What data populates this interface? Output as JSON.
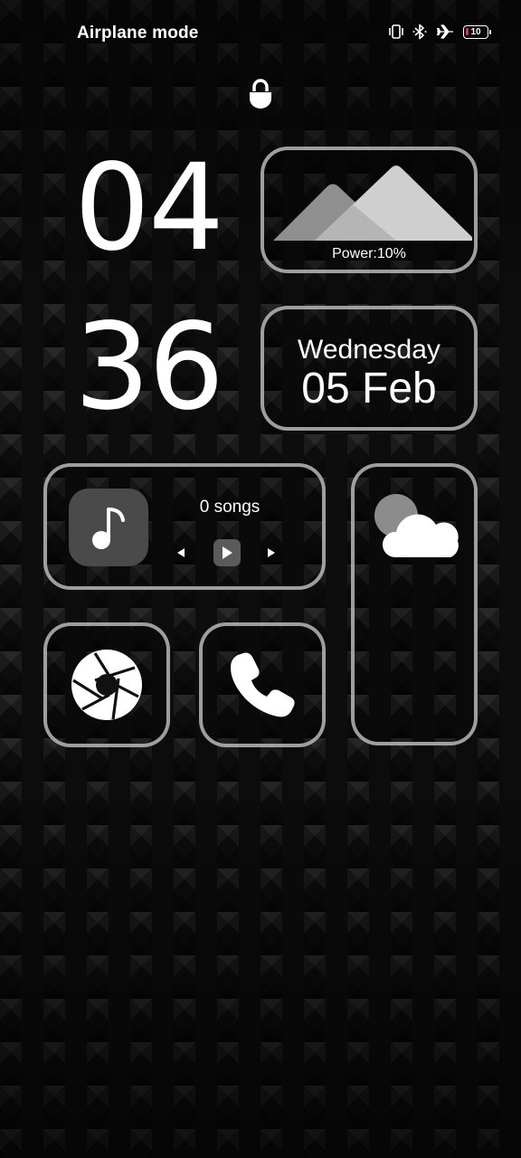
{
  "status_bar": {
    "mode_text": "Airplane mode",
    "icons": [
      "vibrate-icon",
      "bluetooth-icon",
      "airplane-icon",
      "battery-icon"
    ],
    "battery_level": "10",
    "battery_color": "#e0314b"
  },
  "lock": {
    "icon": "lock-icon"
  },
  "clock": {
    "hour": "04",
    "minute": "36"
  },
  "power_widget": {
    "label": "Power:10%",
    "icon": "mountains-icon"
  },
  "date_widget": {
    "day": "Wednesday",
    "date": "05 Feb"
  },
  "music_widget": {
    "count_text": "0 songs",
    "icons": [
      "music-note-icon",
      "previous-icon",
      "play-icon",
      "next-icon"
    ]
  },
  "weather_widget": {
    "icon": "partly-cloudy-icon"
  },
  "shortcuts": {
    "camera_icon": "camera-shutter-icon",
    "phone_icon": "phone-icon"
  },
  "colors": {
    "widget_border": "#b9b9b9",
    "background": "#0d0d0d",
    "text": "#ffffff"
  }
}
